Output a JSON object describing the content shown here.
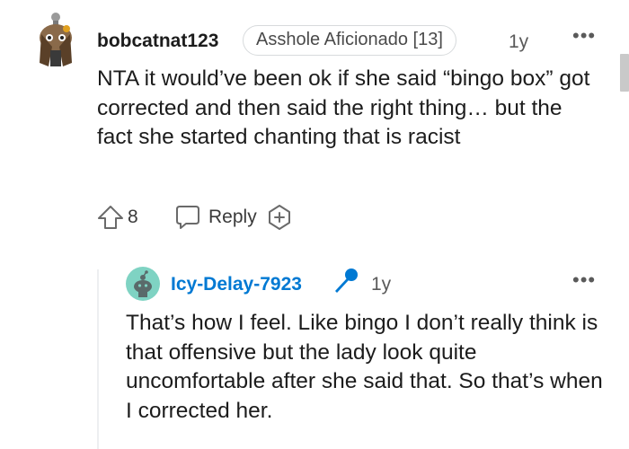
{
  "top_comment": {
    "username": "bobcatnat123",
    "flair": "Asshole Aficionado [13]",
    "age": "1y",
    "more": "•••",
    "body": "NTA it would’ve been ok if she said “bingo box” got corrected and then said the right thing… but the fact she started chanting that is racist",
    "votes": "8",
    "reply_label": "Reply"
  },
  "reply_comment": {
    "username": "Icy-Delay-7923",
    "age": "1y",
    "more": "•••",
    "body": "That’s how I feel. Like bingo I don’t really think is that offensive but the lady look quite uncomfortable after she said that. So that’s when I corrected her."
  },
  "colors": {
    "reply_username": "#0079d3",
    "flair_border": "#d7dadc",
    "mic_icon": "#0079d3",
    "avatar_bg": "#7fd3c3"
  },
  "icons": [
    "avatar-image",
    "upvote-icon",
    "reply-icon",
    "award-add-icon",
    "microphone-icon",
    "snoo-avatar-icon"
  ]
}
